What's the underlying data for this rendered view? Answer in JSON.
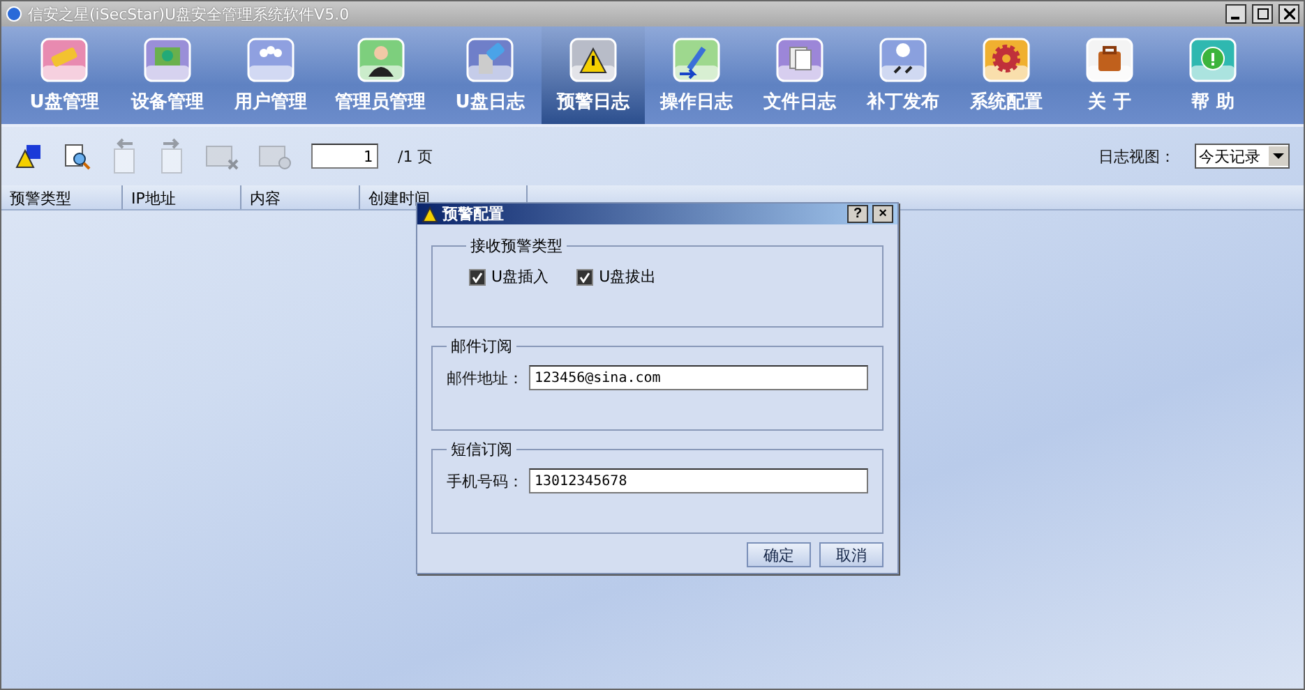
{
  "window": {
    "title": "信安之星(iSecStar)U盘安全管理系统软件V5.0"
  },
  "nav": [
    {
      "label": "U盘管理",
      "selected": false
    },
    {
      "label": "设备管理",
      "selected": false
    },
    {
      "label": "用户管理",
      "selected": false
    },
    {
      "label": "管理员管理",
      "selected": false
    },
    {
      "label": "U盘日志",
      "selected": false
    },
    {
      "label": "预警日志",
      "selected": true
    },
    {
      "label": "操作日志",
      "selected": false
    },
    {
      "label": "文件日志",
      "selected": false
    },
    {
      "label": "补丁发布",
      "selected": false
    },
    {
      "label": "系统配置",
      "selected": false
    },
    {
      "label": "关 于",
      "selected": false
    },
    {
      "label": "帮 助",
      "selected": false
    }
  ],
  "toolbar": {
    "tools": [
      {
        "disabled": false
      },
      {
        "disabled": false
      },
      {
        "disabled": true
      },
      {
        "disabled": true
      },
      {
        "disabled": true
      },
      {
        "disabled": true
      }
    ],
    "page": {
      "value": "1",
      "total": "/1 页"
    },
    "log_view": {
      "label": "日志视图：",
      "value": "今天记录"
    }
  },
  "table": {
    "columns": [
      "预警类型",
      "IP地址",
      "内容",
      "创建时间"
    ]
  },
  "dialog": {
    "title": "预警配置",
    "help": "?",
    "close": "×",
    "alert_group": {
      "title": "接收预警类型",
      "options": [
        {
          "label": "U盘插入",
          "checked": true
        },
        {
          "label": "U盘拔出",
          "checked": true
        }
      ]
    },
    "mail_group": {
      "title": "邮件订阅",
      "label": "邮件地址：",
      "value": "123456@sina.com"
    },
    "sms_group": {
      "title": "短信订阅",
      "label": "手机号码：",
      "value": "13012345678"
    },
    "buttons": [
      "确定",
      "取消"
    ]
  }
}
